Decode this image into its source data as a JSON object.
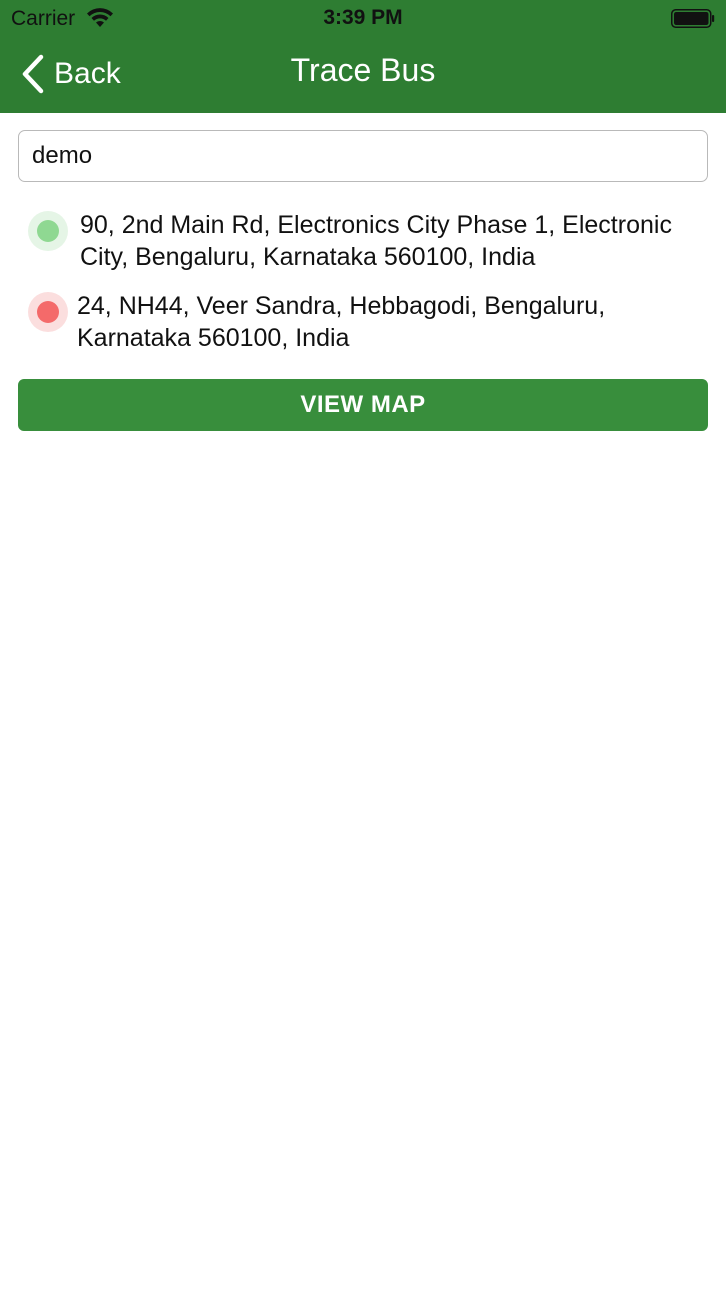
{
  "status_bar": {
    "carrier": "Carrier",
    "time": "3:39 PM",
    "wifi_icon": "wifi-icon",
    "battery_icon": "battery-icon"
  },
  "nav": {
    "back_label": "Back",
    "back_icon": "chevron-left-icon",
    "title": "Trace Bus"
  },
  "search": {
    "value": "demo"
  },
  "stops": [
    {
      "address": "90, 2nd Main Rd, Electronics City Phase 1, Electronic City, Bengaluru, Karnataka 560100, India",
      "marker_color": "#8fd892"
    },
    {
      "address": "24, NH44, Veer Sandra, Hebbagodi, Bengaluru, Karnataka 560100, India",
      "marker_color": "#f46a6a"
    }
  ],
  "view_map_label": "VIEW MAP",
  "colors": {
    "header": "#2e7d32",
    "button": "#388e3c"
  }
}
